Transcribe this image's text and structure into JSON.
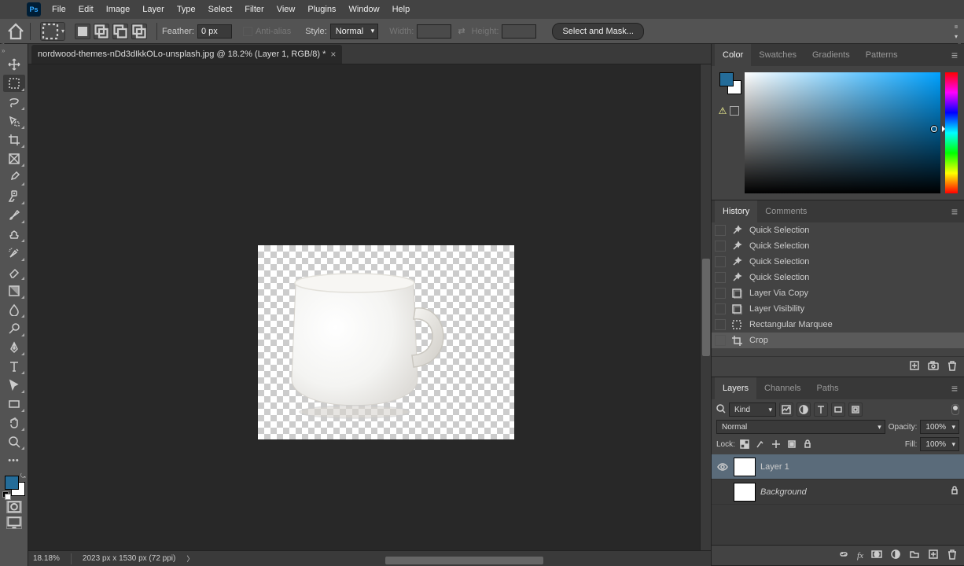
{
  "menubar": [
    "File",
    "Edit",
    "Image",
    "Layer",
    "Type",
    "Select",
    "Filter",
    "View",
    "Plugins",
    "Window",
    "Help"
  ],
  "options": {
    "feather_label": "Feather:",
    "feather_value": "0 px",
    "antialias_label": "Anti-alias",
    "style_label": "Style:",
    "style_value": "Normal",
    "width_label": "Width:",
    "height_label": "Height:",
    "select_mask": "Select and Mask..."
  },
  "doc": {
    "tab_title": "nordwood-themes-nDd3dIkkOLo-unsplash.jpg @ 18.2% (Layer 1, RGB/8) *"
  },
  "status": {
    "zoom": "18.18%",
    "dims": "2023 px x 1530 px (72 ppi)"
  },
  "color_panel": {
    "tabs": [
      "Color",
      "Swatches",
      "Gradients",
      "Patterns"
    ]
  },
  "history_panel": {
    "tabs": [
      "History",
      "Comments"
    ],
    "items": [
      {
        "label": "Quick Selection",
        "icon": "wand"
      },
      {
        "label": "Quick Selection",
        "icon": "wand"
      },
      {
        "label": "Quick Selection",
        "icon": "wand"
      },
      {
        "label": "Quick Selection",
        "icon": "wand"
      },
      {
        "label": "Layer Via Copy",
        "icon": "layer"
      },
      {
        "label": "Layer Visibility",
        "icon": "layer"
      },
      {
        "label": "Rectangular Marquee",
        "icon": "marquee"
      },
      {
        "label": "Crop",
        "icon": "crop",
        "active": true
      }
    ]
  },
  "layers_panel": {
    "tabs": [
      "Layers",
      "Channels",
      "Paths"
    ],
    "kind_label": "Kind",
    "blend_value": "Normal",
    "opacity_label": "Opacity:",
    "opacity_value": "100%",
    "lock_label": "Lock:",
    "fill_label": "Fill:",
    "fill_value": "100%",
    "layers": [
      {
        "name": "Layer 1",
        "visible": true,
        "selected": true,
        "locked": false
      },
      {
        "name": "Background",
        "visible": false,
        "selected": false,
        "locked": true,
        "italic": true
      }
    ]
  }
}
